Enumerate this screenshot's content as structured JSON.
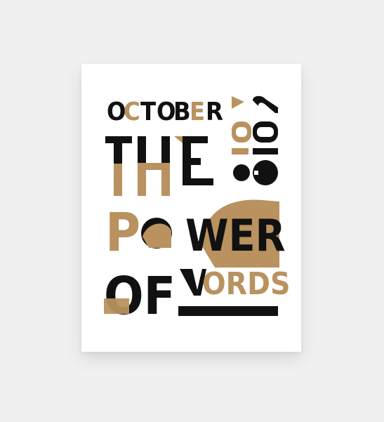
{
  "poster": {
    "month": "OCTOBER",
    "year": "2018",
    "line_the": "THE",
    "line_power": "POWER",
    "line_of": "OF",
    "line_words": "WORDS"
  },
  "colors": {
    "background": "#f0f0f0",
    "paper": "#ffffff",
    "ink": "#111111",
    "gold": "#b9925f"
  }
}
